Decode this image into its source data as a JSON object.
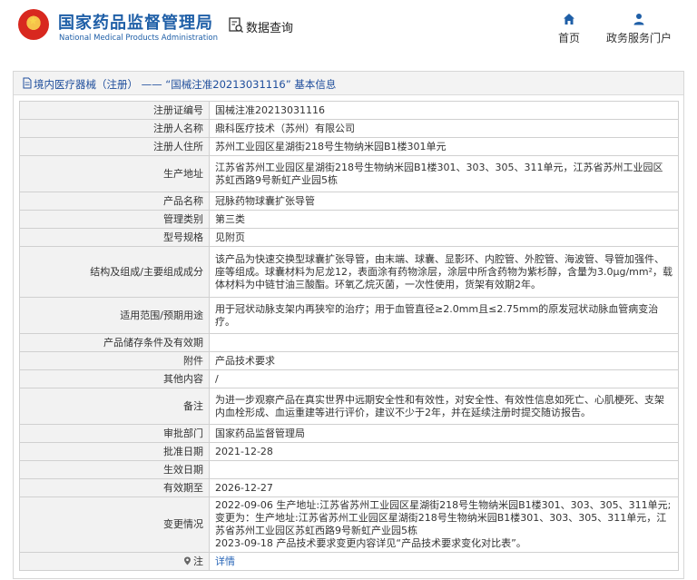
{
  "header": {
    "brand_cn": "国家药品监督管理局",
    "brand_en": "National Medical Products Administration",
    "query_label": "数据查询",
    "nav": [
      {
        "label": "首页",
        "icon": "home-icon"
      },
      {
        "label": "政务服务门户",
        "icon": "user-icon"
      }
    ]
  },
  "breadcrumb": {
    "text": "境内医疗器械（注册） —— “国械注准20213031116” 基本信息"
  },
  "rows": [
    {
      "label": "注册证编号",
      "value": "国械注准20213031116"
    },
    {
      "label": "注册人名称",
      "value": "鼎科医疗技术（苏州）有限公司"
    },
    {
      "label": "注册人住所",
      "value": "苏州工业园区星湖街218号生物纳米园B1楼301单元"
    },
    {
      "label": "生产地址",
      "value": "江苏省苏州工业园区星湖街218号生物纳米园B1楼301、303、305、311单元，江苏省苏州工业园区苏虹西路9号新虹产业园5栋"
    },
    {
      "label": "产品名称",
      "value": "冠脉药物球囊扩张导管"
    },
    {
      "label": "管理类别",
      "value": "第三类"
    },
    {
      "label": "型号规格",
      "value": "见附页"
    },
    {
      "label": "结构及组成/主要组成成分",
      "value": "该产品为快速交换型球囊扩张导管，由末端、球囊、显影环、内腔管、外腔管、海波管、导管加强件、座等组成。球囊材料为尼龙12，表面涂有药物涂层，涂层中所含药物为紫杉醇，含量为3.0μg/mm²，载体材料为中链甘油三酸酯。环氧乙烷灭菌，一次性使用，货架有效期2年。"
    },
    {
      "label": "适用范围/预期用途",
      "value": "用于冠状动脉支架内再狭窄的治疗；用于血管直径≥2.0mm且≤2.75mm的原发冠状动脉血管病变治疗。"
    },
    {
      "label": "产品储存条件及有效期",
      "value": ""
    },
    {
      "label": "附件",
      "value": "产品技术要求"
    },
    {
      "label": "其他内容",
      "value": "/"
    },
    {
      "label": "备注",
      "value": "为进一步观察产品在真实世界中远期安全性和有效性，对安全性、有效性信息如死亡、心肌梗死、支架内血栓形成、血运重建等进行评价，建议不少于2年，并在延续注册时提交随访报告。"
    },
    {
      "label": "审批部门",
      "value": "国家药品监督管理局"
    },
    {
      "label": "批准日期",
      "value": "2021-12-28"
    },
    {
      "label": "生效日期",
      "value": ""
    },
    {
      "label": "有效期至",
      "value": "2026-12-27"
    },
    {
      "label": "变更情况",
      "value": "2022-09-06 生产地址:江苏省苏州工业园区星湖街218号生物纳米园B1楼301、303、305、311单元;变更为：生产地址:江苏省苏州工业园区星湖街218号生物纳米园B1楼301、303、305、311单元，江苏省苏州工业园区苏虹西路9号新虹产业园5栋\n2023-09-18 产品技术要求变更内容详见“产品技术要求变化对比表”。"
    },
    {
      "label": "注",
      "value": "详情"
    }
  ]
}
